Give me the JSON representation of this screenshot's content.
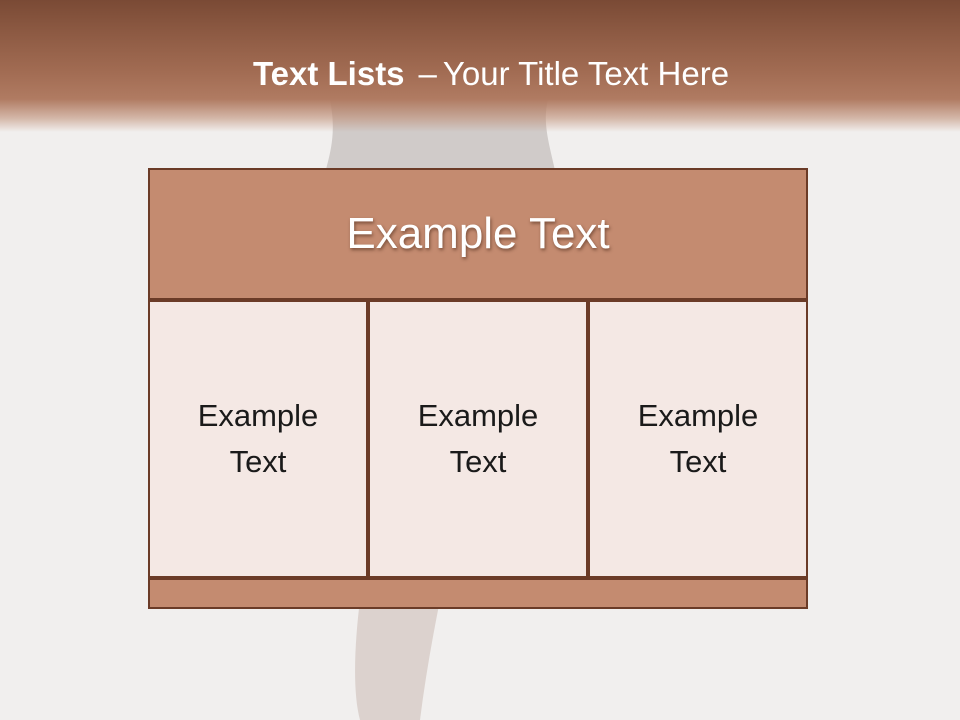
{
  "slide": {
    "title_bold": "Text Lists",
    "title_separator": "–",
    "title_rest": "Your Title Text Here"
  },
  "diagram": {
    "header_text": "Example Text",
    "columns": [
      {
        "text": "Example Text"
      },
      {
        "text": "Example Text"
      },
      {
        "text": "Example Text"
      }
    ]
  },
  "colors": {
    "header_band": "#9a644c",
    "box_fill": "#c48b70",
    "column_fill": "#f4e8e4",
    "border": "#6b3b27",
    "background": "#f1efee"
  }
}
